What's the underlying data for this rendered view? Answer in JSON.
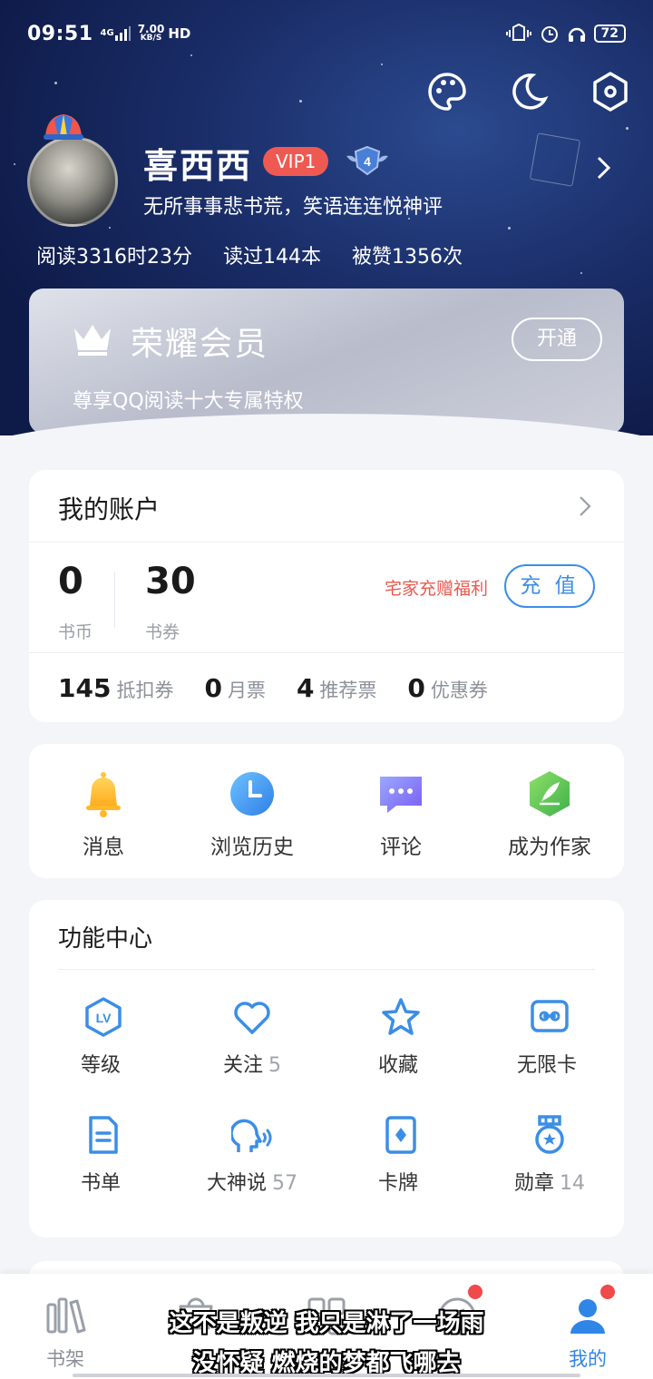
{
  "status": {
    "time": "09:51",
    "net_top": "7.00",
    "net_bottom": "KB/S",
    "hd": "HD",
    "sig_type": "4G",
    "battery": "72"
  },
  "profile": {
    "name": "喜西西",
    "vip": "VIP1",
    "level": "4",
    "signature": "无所事事悲书荒，笑语连连悦神评",
    "stats": [
      "阅读3316时23分",
      "读过144本",
      "被赞1356次"
    ]
  },
  "vip_card": {
    "title": "荣耀会员",
    "desc": "尊享QQ阅读十大专属特权",
    "button": "开通"
  },
  "account": {
    "title": "我的账户",
    "coins_value": "0",
    "coins_label": "书币",
    "vouchers_value": "30",
    "vouchers_label": "书券",
    "promo": "宅家充赠福利",
    "recharge": "充 值",
    "tickets": [
      {
        "value": "145",
        "label": "抵扣券"
      },
      {
        "value": "0",
        "label": "月票"
      },
      {
        "value": "4",
        "label": "推荐票"
      },
      {
        "value": "0",
        "label": "优惠券"
      }
    ]
  },
  "quick": [
    {
      "label": "消息",
      "icon": "bell-icon"
    },
    {
      "label": "浏览历史",
      "icon": "clock-icon"
    },
    {
      "label": "评论",
      "icon": "chat-icon"
    },
    {
      "label": "成为作家",
      "icon": "pen-icon"
    }
  ],
  "functions": {
    "title": "功能中心",
    "items": [
      {
        "label": "等级",
        "count": "",
        "icon": "level-icon"
      },
      {
        "label": "关注",
        "count": "5",
        "icon": "heart-icon"
      },
      {
        "label": "收藏",
        "count": "",
        "icon": "star-icon"
      },
      {
        "label": "无限卡",
        "count": "",
        "icon": "infinity-card-icon"
      },
      {
        "label": "书单",
        "count": "",
        "icon": "booklist-icon"
      },
      {
        "label": "大神说",
        "count": "57",
        "icon": "speaker-head-icon"
      },
      {
        "label": "卡牌",
        "count": "",
        "icon": "card-icon"
      },
      {
        "label": "勋章",
        "count": "14",
        "icon": "medal-icon"
      }
    ]
  },
  "tabs": [
    {
      "label": "书架",
      "icon": "bookshelf-icon"
    },
    {
      "label": "",
      "icon": "store-icon"
    },
    {
      "label": "",
      "icon": "category-icon"
    },
    {
      "label": "",
      "icon": "discover-icon"
    },
    {
      "label": "我的",
      "icon": "profile-icon"
    }
  ],
  "subtitles": [
    "这不是叛逆 我只是淋了一场雨",
    "没怀疑 燃烧的梦都飞哪去"
  ],
  "colors": {
    "accent": "#2f86e6",
    "vip_red": "#ee5a52",
    "promo_red": "#e85a4f",
    "header_navy": "#1a2d68"
  }
}
